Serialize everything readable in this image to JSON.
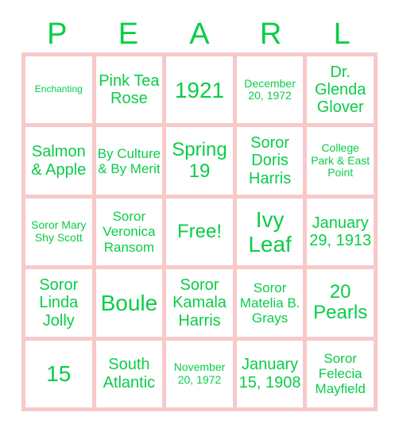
{
  "card": {
    "title": "PEARL Bingo Card",
    "accent_text_color": "#0ACD48",
    "grid_border_color": "#F8C9C9",
    "cell_background_color": "#FFFFFF",
    "page_background_color": "#FFFFFF",
    "columns": 5,
    "rows": 5
  },
  "header": {
    "letters": [
      {
        "label": "P"
      },
      {
        "label": "E"
      },
      {
        "label": "A"
      },
      {
        "label": "R"
      },
      {
        "label": "L"
      }
    ]
  },
  "grid": {
    "cells": [
      {
        "text": "Enchanting",
        "size": "fs-xs",
        "column": "P",
        "row": 1,
        "free": false
      },
      {
        "text": "Pink Tea Rose",
        "size": "fs-lg",
        "column": "E",
        "row": 1,
        "free": false
      },
      {
        "text": "1921",
        "size": "fs-xxl",
        "column": "A",
        "row": 1,
        "free": false
      },
      {
        "text": "December 20, 1972",
        "size": "fs-sm",
        "column": "R",
        "row": 1,
        "free": false
      },
      {
        "text": "Dr. Glenda Glover",
        "size": "fs-lg",
        "column": "L",
        "row": 1,
        "free": false
      },
      {
        "text": "Salmon & Apple",
        "size": "fs-lg",
        "column": "P",
        "row": 2,
        "free": false
      },
      {
        "text": "By Culture & By Merit",
        "size": "fs-md",
        "column": "E",
        "row": 2,
        "free": false
      },
      {
        "text": "Spring 19",
        "size": "fs-xl",
        "column": "A",
        "row": 2,
        "free": false
      },
      {
        "text": "Soror Doris Harris",
        "size": "fs-lg",
        "column": "R",
        "row": 2,
        "free": false
      },
      {
        "text": "College Park & East Point",
        "size": "fs-sm",
        "column": "L",
        "row": 2,
        "free": false
      },
      {
        "text": "Soror Mary Shy Scott",
        "size": "fs-sm",
        "column": "P",
        "row": 3,
        "free": false
      },
      {
        "text": "Soror Veronica Ransom",
        "size": "fs-md",
        "column": "E",
        "row": 3,
        "free": false
      },
      {
        "text": "Free!",
        "size": "fs-xl",
        "column": "A",
        "row": 3,
        "free": true
      },
      {
        "text": "Ivy Leaf",
        "size": "fs-xxl",
        "column": "R",
        "row": 3,
        "free": false
      },
      {
        "text": "January 29, 1913",
        "size": "fs-lg",
        "column": "L",
        "row": 3,
        "free": false
      },
      {
        "text": "Soror Linda Jolly",
        "size": "fs-lg",
        "column": "P",
        "row": 4,
        "free": false
      },
      {
        "text": "Boule",
        "size": "fs-xxl",
        "column": "E",
        "row": 4,
        "free": false
      },
      {
        "text": "Soror Kamala Harris",
        "size": "fs-lg",
        "column": "A",
        "row": 4,
        "free": false
      },
      {
        "text": "Soror Matelia B. Grays",
        "size": "fs-md",
        "column": "R",
        "row": 4,
        "free": false
      },
      {
        "text": "20 Pearls",
        "size": "fs-xl",
        "column": "L",
        "row": 4,
        "free": false
      },
      {
        "text": "15",
        "size": "fs-xxl",
        "column": "P",
        "row": 5,
        "free": false
      },
      {
        "text": "South Atlantic",
        "size": "fs-lg",
        "column": "E",
        "row": 5,
        "free": false
      },
      {
        "text": "November 20, 1972",
        "size": "fs-sm",
        "column": "A",
        "row": 5,
        "free": false
      },
      {
        "text": "January 15, 1908",
        "size": "fs-lg",
        "column": "R",
        "row": 5,
        "free": false
      },
      {
        "text": "Soror Felecia Mayfield",
        "size": "fs-md",
        "column": "L",
        "row": 5,
        "free": false
      }
    ]
  }
}
